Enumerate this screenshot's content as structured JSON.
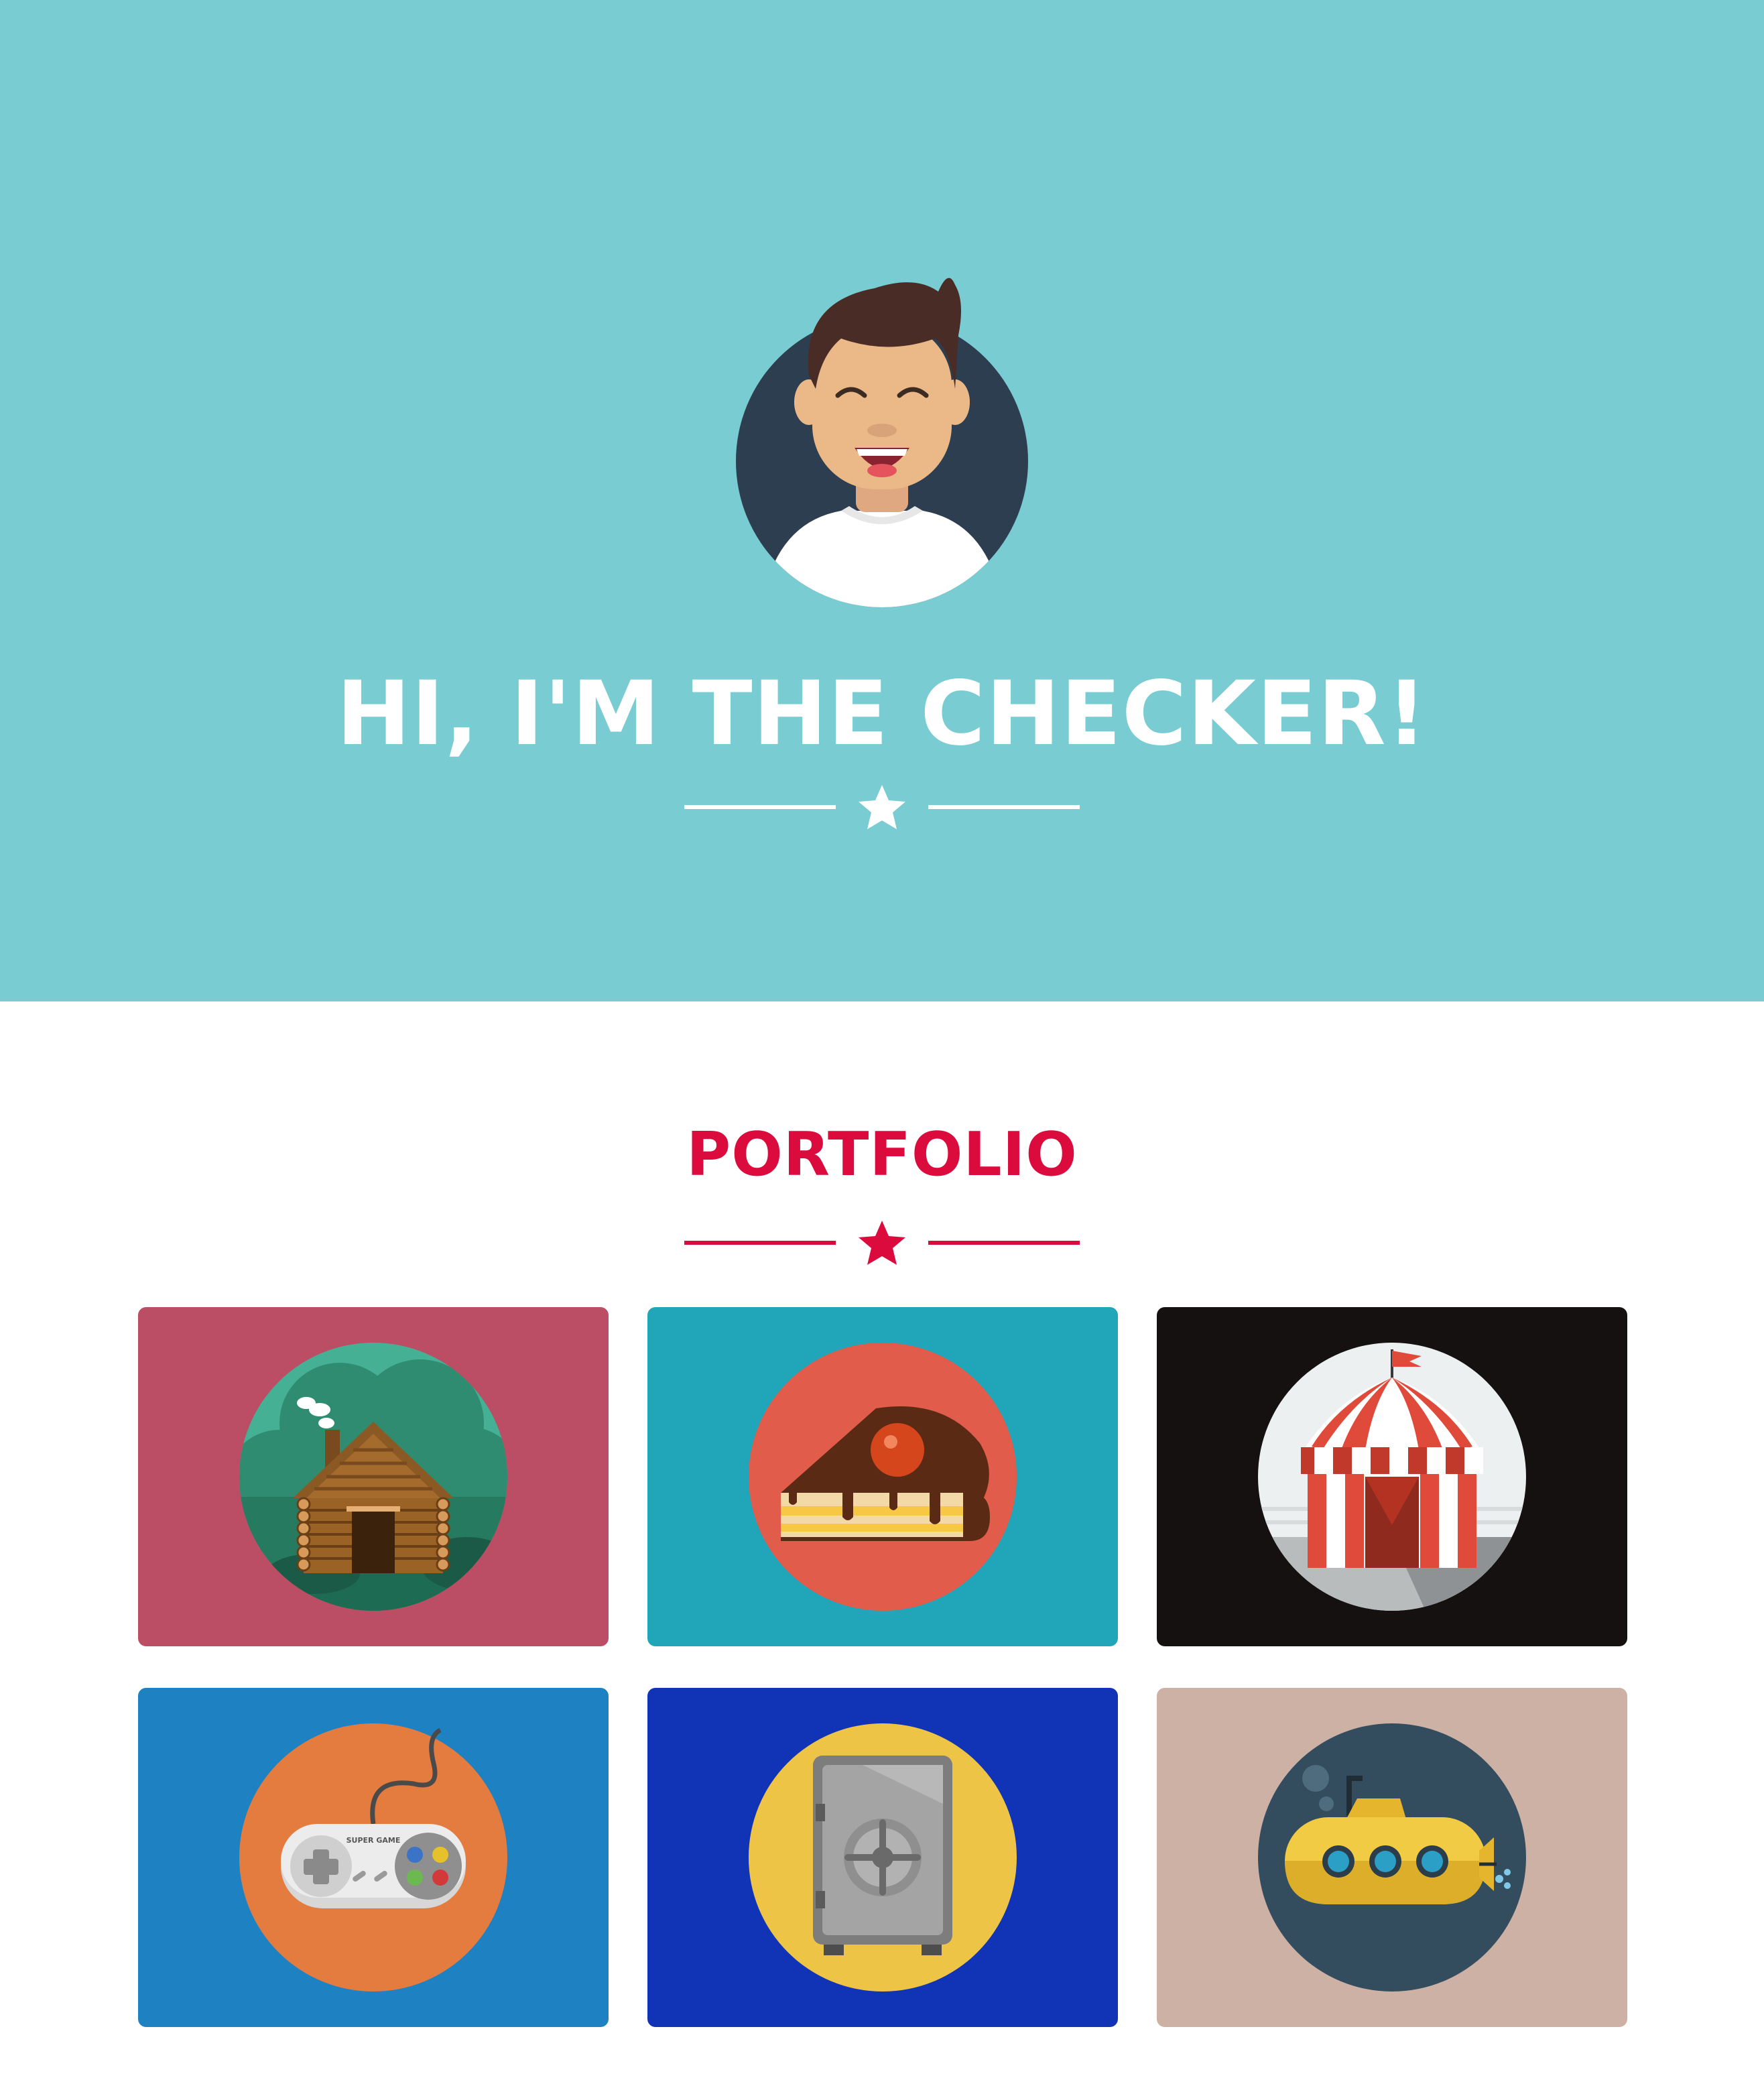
{
  "hero": {
    "title": "HI, I'M THE CHECKER!",
    "background_color": "#79cdd2",
    "avatar_icon": "smiling-man-avatar-icon",
    "divider_icon": "star-icon"
  },
  "portfolio": {
    "title": "PORTFOLIO",
    "accent_color": "#dc0b3e",
    "divider_icon": "star-icon",
    "items": [
      {
        "icon": "log-cabin-icon",
        "background": "#bb4e64"
      },
      {
        "icon": "cake-slice-icon",
        "background": "#21a5b8"
      },
      {
        "icon": "circus-tent-icon",
        "background": "#141110"
      },
      {
        "icon": "game-controller-icon",
        "background": "#1e82c2"
      },
      {
        "icon": "safe-icon",
        "background": "#1034b5"
      },
      {
        "icon": "submarine-icon",
        "background": "#cdb1a4"
      }
    ]
  },
  "controller_label": "SUPER GAME"
}
